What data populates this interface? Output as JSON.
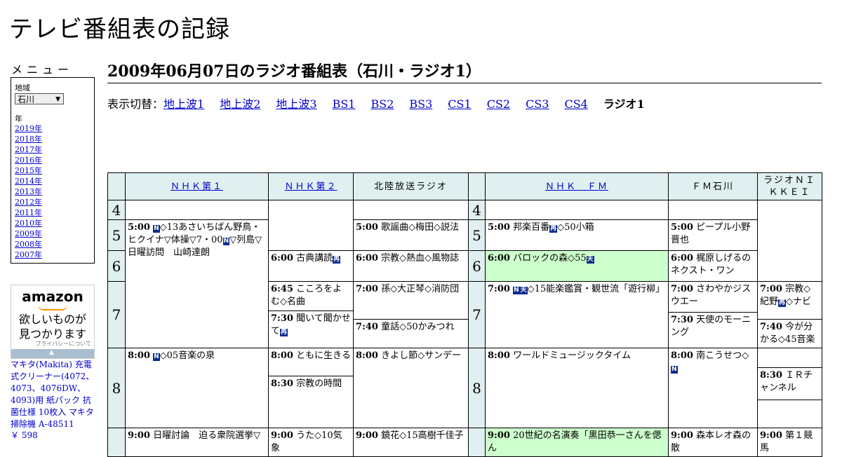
{
  "site_title": "テレビ番組表の記録",
  "menu": {
    "title": "メニュー",
    "region_label": "地域",
    "region_value": "石川",
    "year_label": "年",
    "years": [
      "2019年",
      "2018年",
      "2017年",
      "2016年",
      "2015年",
      "2014年",
      "2013年",
      "2012年",
      "2011年",
      "2010年",
      "2009年",
      "2008年",
      "2007年"
    ]
  },
  "ad": {
    "brand": "amazon",
    "copy_line1": "欲しいものが",
    "copy_line2": "見つかります",
    "privacy": "プライバシーについて",
    "product": "マキタ(Makita) 充電式クリーナー(4072、4073、4076DW、4093)用 紙パック 抗菌仕様 10枚入 マキタ 掃除機 A-48511",
    "price": "￥ 598"
  },
  "heading": "2009年06月07日のラジオ番組表（石川・ラジオ1）",
  "switch": {
    "label": "表示切替：",
    "links": [
      "地上波1",
      "地上波2",
      "地上波3",
      "BS1",
      "BS2",
      "BS3",
      "CS1",
      "CS2",
      "CS3",
      "CS4"
    ],
    "current": "ラジオ1"
  },
  "badges": {
    "n": "N",
    "ten": "天",
    "sai": "再"
  },
  "channels": [
    "ＮＨＫ第１",
    "ＮＨＫ第２",
    "北陸放送ラジオ",
    "ＮＨＫ　ＦＭ",
    "ＦＭ石川",
    "ラジオＮＩＫＫＥＩ"
  ],
  "hours": [
    "4",
    "5",
    "6",
    "7",
    "8"
  ],
  "programs": {
    "nhk1_500_t": "5:00",
    "nhk1_500_a": "◇13あさいちばん野鳥・ヒクイナ▽体操▽7・00",
    "nhk1_500_b": "▽列島▽日曜訪問　山崎達朗",
    "nhk1_800_t": "8:00",
    "nhk1_800": "◇05音楽の泉",
    "nhk1_900_t": "9:00",
    "nhk1_900": "日曜討論　迫る衆院選挙▽",
    "nhk2_600_t": "6:00",
    "nhk2_600": "古典講読",
    "nhk2_645_t": "6:45",
    "nhk2_645": "こころをよむ◇名曲",
    "nhk2_730_t": "7:30",
    "nhk2_730": "聞いて聞かせて",
    "nhk2_800_t": "8:00",
    "nhk2_800": "ともに生きる",
    "nhk2_830_t": "8:30",
    "nhk2_830": "宗教の時間",
    "nhk2_900_t": "9:00",
    "nhk2_900": "うた◇10気象",
    "mro_500_t": "5:00",
    "mro_500": "歌謡曲◇梅田◇説法",
    "mro_600_t": "6:00",
    "mro_600": "宗教◇熱血◇風物誌",
    "mro_700_t": "7:00",
    "mro_700": "孫◇大正琴◇消防団",
    "mro_740_t": "7:40",
    "mro_740": "童話◇50かみつれ",
    "mro_800_t": "8:00",
    "mro_800": "きよし節◇サンデー",
    "mro_900_t": "9:00",
    "mro_900": "鏡花◇15高樹千佳子",
    "fm_500_t": "5:00",
    "fm_500_a": "邦楽百番",
    "fm_500_b": "◇50小箱",
    "fm_600_t": "6:00",
    "fm_600": "バロックの森◇55",
    "fm_700_t": "7:00",
    "fm_700": "◇15能楽鑑賞・観世流「遊行柳」",
    "fm_800_t": "8:00",
    "fm_800": "ワールドミュージックタイム",
    "fm_900_t": "9:00",
    "fm_900": "20世紀の名演奏「黒田恭一さんを偲ん",
    "hfm_500_t": "5:00",
    "hfm_500": "ピープル小野晋也",
    "hfm_600_t": "6:00",
    "hfm_600": "梶原しげるのネクスト・ワン",
    "hfm_700_t": "7:00",
    "hfm_700": "さわやかジスウエー",
    "hfm_730_t": "7:30",
    "hfm_730": "天使のモーニング",
    "hfm_800_t": "8:00",
    "hfm_800": "南こうせつ◇",
    "hfm_900_t": "9:00",
    "hfm_900": "森本レオ森の散",
    "nik_700_t": "7:00",
    "nik_700_a": "宗教◇紀野",
    "nik_700_b": "◇ナビ",
    "nik_740_t": "7:40",
    "nik_740": "今が分かる◇45音楽",
    "nik_830_t": "8:30",
    "nik_830": "ＩＲチャンネル",
    "nik_900_t": "9:00",
    "nik_900": "第１競馬"
  }
}
